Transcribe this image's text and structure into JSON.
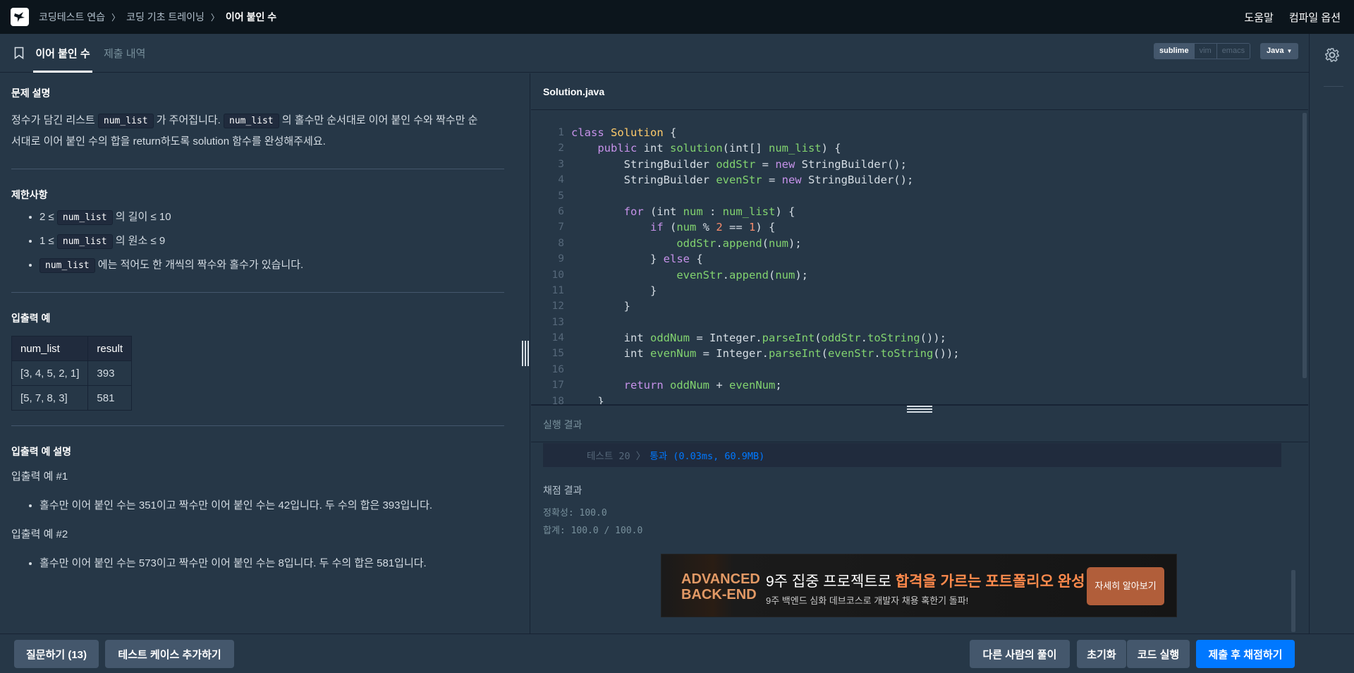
{
  "topnav": {
    "logo_icon": "programmers-logo-icon",
    "breadcrumbs": [
      "코딩테스트 연습",
      "코딩 기초 트레이닝",
      "이어 붙인 수"
    ],
    "help": "도움말",
    "compile_options": "컴파일 옵션"
  },
  "tabs": {
    "active": "이어 붙인 수",
    "inactive": "제출 내역",
    "bookmark_icon": "bookmark-icon"
  },
  "editor_modes": [
    "sublime",
    "vim",
    "emacs"
  ],
  "selected_mode": "sublime",
  "language": "Java",
  "problem": {
    "desc_title": "문제 설명",
    "desc_p1a": "정수가 담긴 리스트 ",
    "code_num_list": "num_list",
    "desc_p1b": " 가 주어집니다. ",
    "desc_p1c": " 의 홀수만 순서대로 이어 붙인 수와 짝수만 순",
    "desc_p2": "서대로 이어 붙인 수의 합을 return하도록 solution 함수를 완성해주세요.",
    "limit_title": "제한사항",
    "limit1_pre": "2 ≤ ",
    "limit1_post": " 의 길이 ≤ 10",
    "limit2_pre": "1 ≤ ",
    "limit2_post": " 의 원소 ≤ 9",
    "limit3_post": " 에는 적어도 한 개씩의 짝수와 홀수가 있습니다.",
    "io_title": "입출력 예",
    "io_headers": [
      "num_list",
      "result"
    ],
    "io_rows": [
      [
        "[3, 4, 5, 2, 1]",
        "393"
      ],
      [
        "[5, 7, 8, 3]",
        "581"
      ]
    ],
    "io_expl_title": "입출력 예 설명",
    "ex1_title": "입출력 예 #1",
    "ex1_item": "홀수만 이어 붙인 수는 351이고 짝수만 이어 붙인 수는 42입니다. 두 수의 합은 393입니다.",
    "ex2_title": "입출력 예 #2",
    "ex2_item": "홀수만 이어 붙인 수는 573이고 짝수만 이어 붙인 수는 8입니다. 두 수의 합은 581입니다."
  },
  "editor": {
    "filename": "Solution.java",
    "line_numbers": [
      "1",
      "2",
      "3",
      "4",
      "5",
      "6",
      "7",
      "8",
      "9",
      "10",
      "11",
      "12",
      "13",
      "14",
      "15",
      "16",
      "17",
      "18"
    ]
  },
  "result": {
    "title": "실행 결과",
    "test_label": "테스트 20 〉",
    "test_result": "통과 (0.03ms, 60.9MB)",
    "score_title": "채점 결과",
    "accuracy": "정확성: 100.0",
    "total": "합계: 100.0 / 100.0"
  },
  "ad": {
    "left_line1": "ADVANCED",
    "left_line2": "BACK-END",
    "main_pre": "9주 집중 프로젝트로 ",
    "main_hl": "합격을 가르는 포트폴리오 완성",
    "sub": "9주 백엔드 심화 데브코스로 개발자 채용 혹한기 돌파!",
    "button": "자세히 알아보기"
  },
  "buttons": {
    "question": "질문하기 (13)",
    "add_testcase": "테스트 케이스 추가하기",
    "others_solution": "다른 사람의 풀이",
    "reset": "초기화",
    "run": "코드 실행",
    "submit": "제출 후 채점하기"
  },
  "settings_icon": "gear-icon"
}
